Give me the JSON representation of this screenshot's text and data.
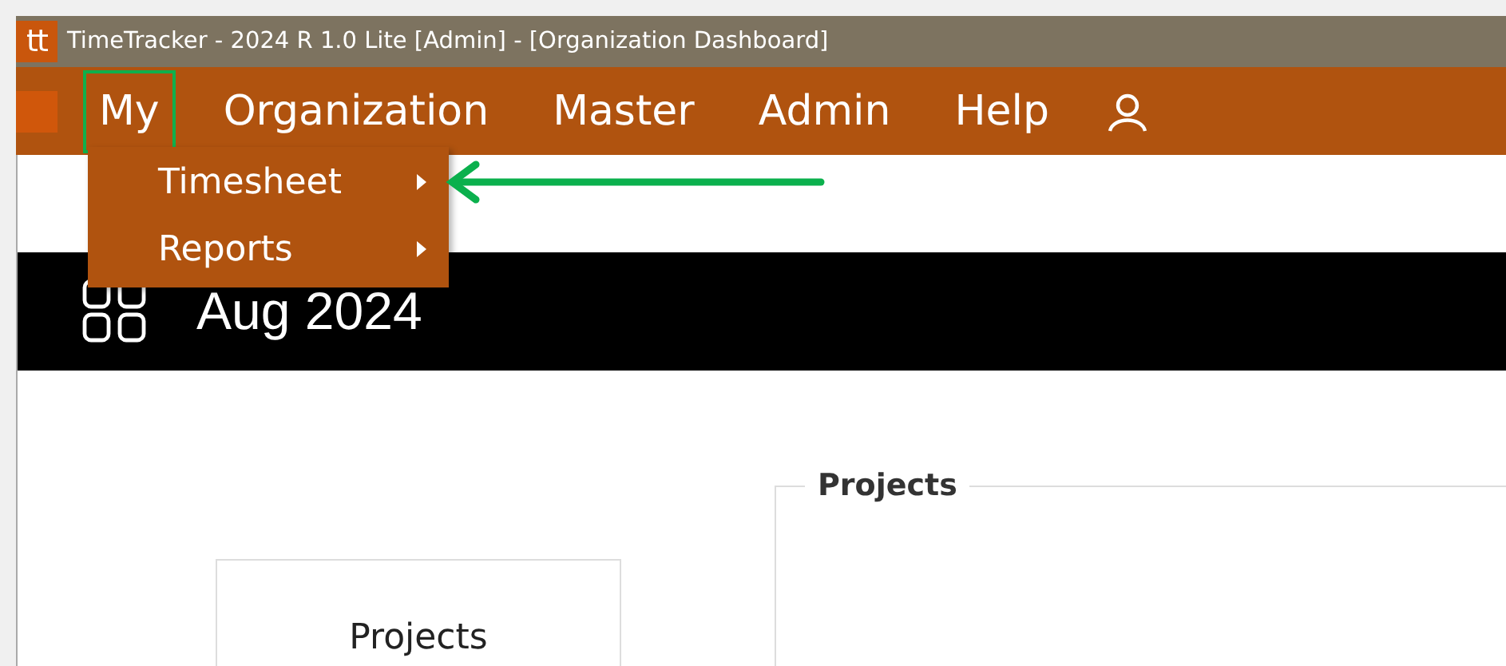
{
  "window": {
    "icon_text": "tt",
    "title": "TimeTracker - 2024 R 1.0 Lite [Admin] - [Organization Dashboard]"
  },
  "menu": [
    {
      "label": "My",
      "selected": true
    },
    {
      "label": "Organization",
      "selected": false
    },
    {
      "label": "Master",
      "selected": false
    },
    {
      "label": "Admin",
      "selected": false
    },
    {
      "label": "Help",
      "selected": false
    }
  ],
  "dropdown": [
    {
      "label": "Timesheet",
      "has_submenu": true,
      "pointed": true
    },
    {
      "label": "Reports",
      "has_submenu": true,
      "pointed": false
    }
  ],
  "banner": {
    "title": "Aug 2024"
  },
  "tile": {
    "label": "Projects"
  },
  "panel": {
    "legend": "Projects"
  }
}
